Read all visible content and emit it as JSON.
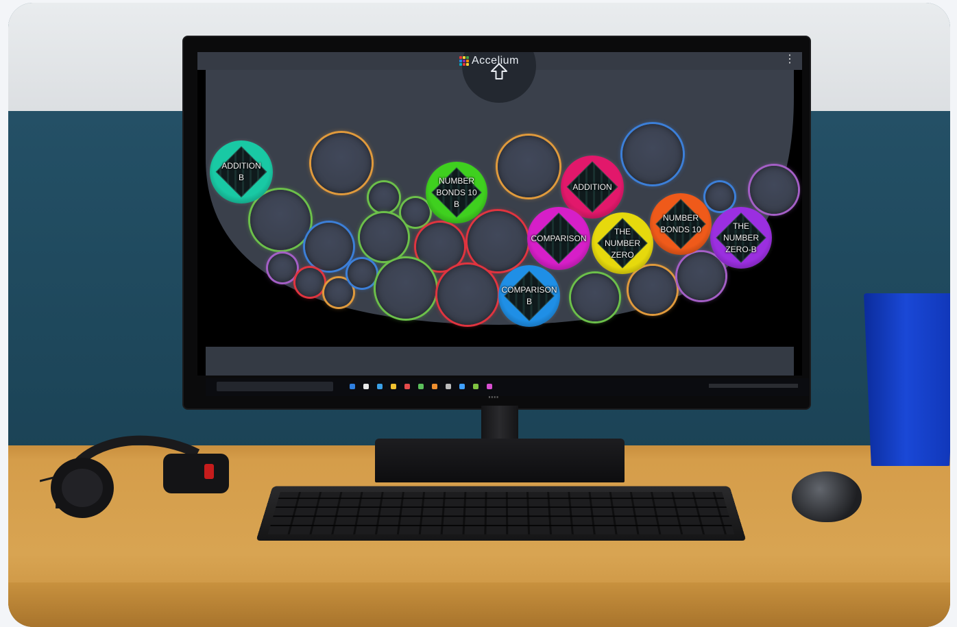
{
  "app": {
    "brand_name": "Accelium",
    "menu_icon": "kebab-menu-icon",
    "home_icon": "up-arrow-icon"
  },
  "topics": [
    {
      "id": "addition-b",
      "label": "ADDITION\nB",
      "color": "#19c9a4"
    },
    {
      "id": "number-bonds-10-b",
      "label": "NUMBER\nBONDS 10\nB",
      "color": "#3fd01f"
    },
    {
      "id": "addition",
      "label": "ADDITION",
      "color": "#e2186b"
    },
    {
      "id": "comparison",
      "label": "COMPARISON",
      "color": "#d61fc8"
    },
    {
      "id": "the-number-zero",
      "label": "THE\nNUMBER\nZERO",
      "color": "#e6d90d"
    },
    {
      "id": "number-bonds-10",
      "label": "NUMBER\nBONDS 10",
      "color": "#ef5a1a"
    },
    {
      "id": "the-number-zero-b",
      "label": "THE\nNUMBER\nZERO-B",
      "color": "#9b2fe0"
    },
    {
      "id": "comparison-b",
      "label": "COMPARISON\nB",
      "color": "#1f8fe6"
    }
  ],
  "empty_bubble_colors": {
    "green": "#6cc04a",
    "orange": "#e09a3c",
    "red": "#e0343f",
    "blue": "#3c7fd8",
    "purple": "#a45fc6"
  },
  "taskbar": {
    "icons": [
      "#2f7fe0",
      "#e8e8e8",
      "#3aa0e6",
      "#f2c230",
      "#e54b4b",
      "#5bbf5b",
      "#ef8f2f",
      "#bbbbbb",
      "#3fa0ff",
      "#7fc241",
      "#d84fd0"
    ]
  },
  "logo_dots": [
    "#e53935",
    "#fdd835",
    "#43a047",
    "#1e88e5",
    "#8e24aa",
    "#fb8c00",
    "#00acc1",
    "#e53935",
    "#fdd835"
  ]
}
